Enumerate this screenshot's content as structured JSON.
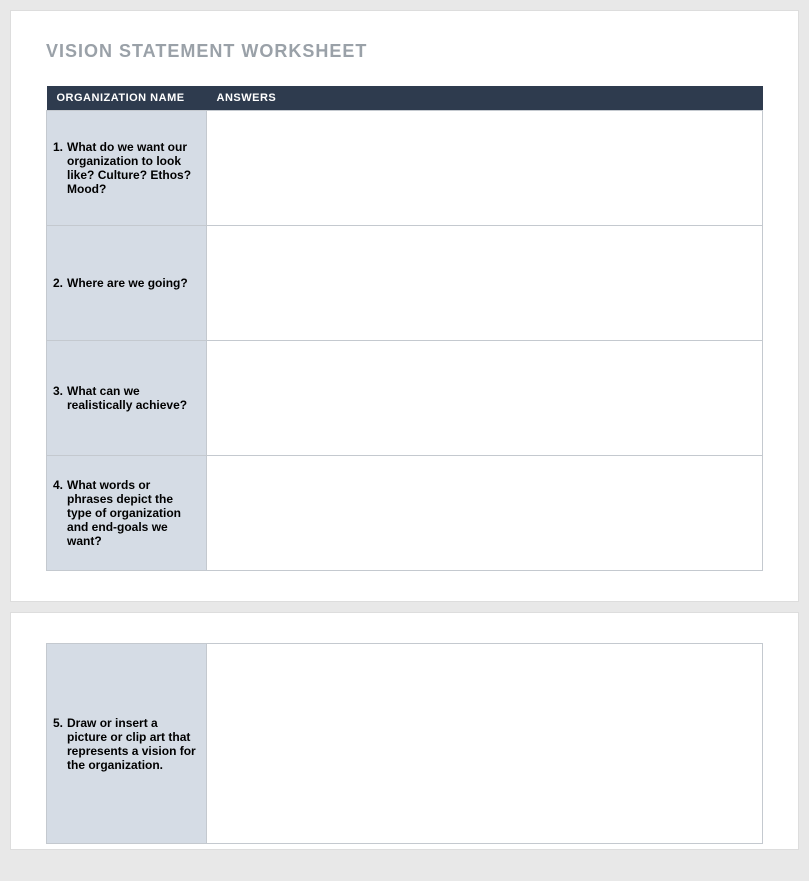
{
  "title": "VISION STATEMENT WORKSHEET",
  "headers": {
    "org": "ORGANIZATION NAME",
    "answers": "ANSWERS"
  },
  "page1_rows": [
    {
      "num": "1.",
      "text": "What do we want our organization to look like? Culture? Ethos? Mood?",
      "answer": ""
    },
    {
      "num": "2.",
      "text": "Where are we going?",
      "answer": ""
    },
    {
      "num": "3.",
      "text": "What can we realistically achieve?",
      "answer": ""
    },
    {
      "num": "4.",
      "text": "What words or phrases depict the type of organization and end-goals we want?",
      "answer": ""
    }
  ],
  "page2_rows": [
    {
      "num": "5.",
      "text": "Draw or insert a picture or clip art that represents a vision for the organization.",
      "answer": ""
    }
  ]
}
